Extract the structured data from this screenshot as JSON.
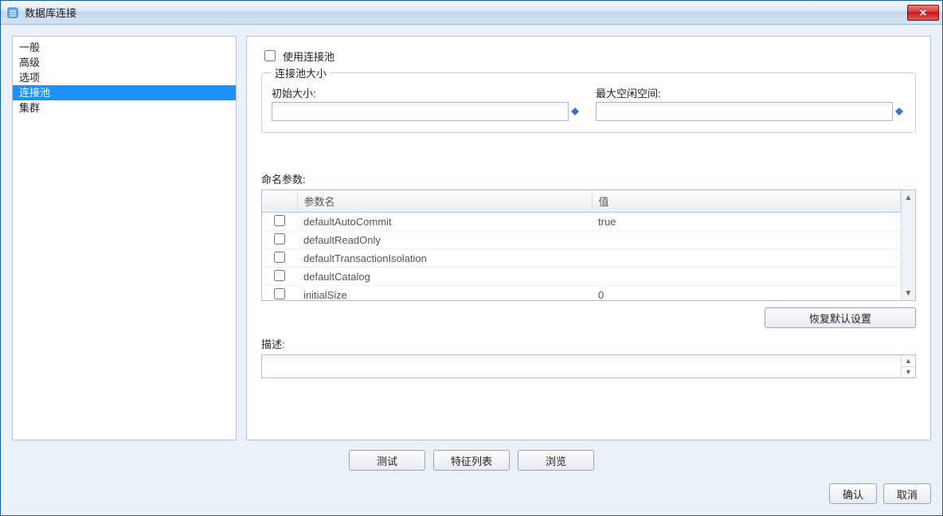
{
  "window": {
    "title": "数据库连接"
  },
  "sidebar": {
    "items": [
      {
        "label": "一般",
        "selected": false
      },
      {
        "label": "高级",
        "selected": false
      },
      {
        "label": "选项",
        "selected": false
      },
      {
        "label": "连接池",
        "selected": true
      },
      {
        "label": "集群",
        "selected": false
      }
    ]
  },
  "main": {
    "use_pool_label": "使用连接池",
    "use_pool_checked": false,
    "pool_group_legend": "连接池大小",
    "initial_size_label": "初始大小:",
    "initial_size_value": "",
    "max_idle_label": "最大空闲空间:",
    "max_idle_value": "",
    "named_params_label": "命名参数:",
    "table": {
      "col_checkbox": "",
      "col_param": "参数名",
      "col_value": "值",
      "rows": [
        {
          "checked": false,
          "param": "defaultAutoCommit",
          "value": "true"
        },
        {
          "checked": false,
          "param": "defaultReadOnly",
          "value": ""
        },
        {
          "checked": false,
          "param": "defaultTransactionIsolation",
          "value": ""
        },
        {
          "checked": false,
          "param": "defaultCatalog",
          "value": ""
        },
        {
          "checked": false,
          "param": "initialSize",
          "value": "0"
        }
      ]
    },
    "restore_defaults_label": "恢复默认设置",
    "description_label": "描述:",
    "description_value": ""
  },
  "buttons": {
    "test": "测试",
    "schema": "特征列表",
    "browse": "浏览",
    "ok": "确认",
    "cancel": "取消"
  }
}
